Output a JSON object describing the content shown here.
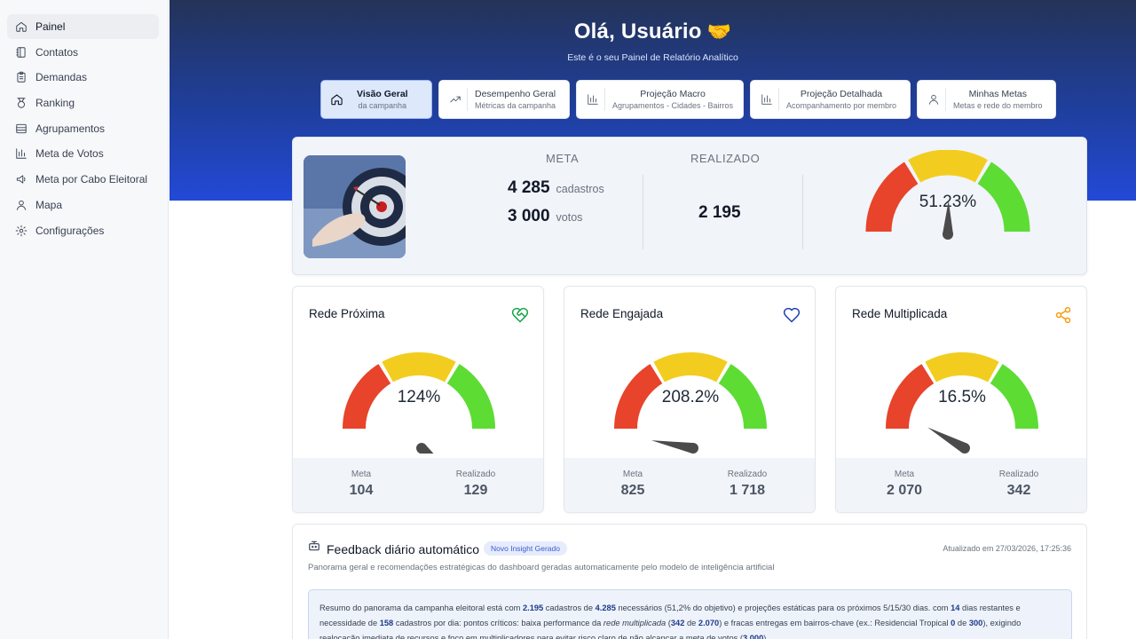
{
  "sidebar": {
    "items": [
      {
        "label": "Painel",
        "icon": "home-icon",
        "active": true
      },
      {
        "label": "Contatos",
        "icon": "contacts-book-icon"
      },
      {
        "label": "Demandas",
        "icon": "clipboard-icon"
      },
      {
        "label": "Ranking",
        "icon": "medal-icon"
      },
      {
        "label": "Agrupamentos",
        "icon": "layers-icon"
      },
      {
        "label": "Meta de Votos",
        "icon": "bar-chart-icon"
      },
      {
        "label": "Meta por Cabo Eleitoral",
        "icon": "megaphone-icon"
      },
      {
        "label": "Mapa",
        "icon": "map-pin-icon"
      },
      {
        "label": "Configurações",
        "icon": "gear-icon"
      }
    ]
  },
  "header": {
    "greeting": "Olá, Usuário",
    "greeting_icon": "handshake-icon",
    "subtitle": "Este é o seu Painel de Relatório Analítico"
  },
  "tabs": [
    {
      "title": "Visão Geral",
      "sub": "da campanha",
      "icon": "home-icon",
      "active": true
    },
    {
      "title": "Desempenho Geral",
      "sub": "Métricas da campanha",
      "icon": "trending-up-icon"
    },
    {
      "title": "Projeção Macro",
      "sub": "Agrupamentos - Cidades - Bairros",
      "icon": "bar-chart-icon"
    },
    {
      "title": "Projeção Detalhada",
      "sub": "Acompanhamento por membro",
      "icon": "bar-chart-icon"
    },
    {
      "title": "Minhas Metas",
      "sub": "Metas e rede do membro",
      "icon": "user-icon"
    }
  ],
  "summary": {
    "meta_label": "META",
    "realizado_label": "REALIZADO",
    "meta_cadastros": "4 285",
    "meta_cadastros_unit": "cadastros",
    "meta_votos": "3 000",
    "meta_votos_unit": "votos",
    "realizado": "2 195",
    "gauge_text": "51.23%",
    "gauge_value": 51.23
  },
  "networks": [
    {
      "title": "Rede Próxima",
      "icon": "heart-handshake-icon",
      "icon_color": "#16a34a",
      "percent_text": "124%",
      "percent": 124,
      "meta_label": "Meta",
      "meta": "104",
      "realizado_label": "Realizado",
      "realizado": "129"
    },
    {
      "title": "Rede Engajada",
      "icon": "heart-icon",
      "icon_color": "#1e40af",
      "percent_text": "208.2%",
      "percent": 208.2,
      "meta_label": "Meta",
      "meta": "825",
      "realizado_label": "Realizado",
      "realizado": "1 718"
    },
    {
      "title": "Rede Multiplicada",
      "icon": "share-icon",
      "icon_color": "#f59e0b",
      "percent_text": "16.5%",
      "percent": 16.5,
      "meta_label": "Meta",
      "meta": "2 070",
      "realizado_label": "Realizado",
      "realizado": "342"
    }
  ],
  "feedback": {
    "title": "Feedback diário automático",
    "icon": "bot-icon",
    "badge": "Novo Insight Gerado",
    "updated": "Atualizado em 27/03/2026, 17:25:36",
    "description": "Panorama geral e recomendações estratégicas do dashboard geradas automaticamente pelo modelo de inteligência artificial",
    "body_parts": [
      {
        "t": "Resumo do panorama da campanha eleitoral está com ",
        "s": "n"
      },
      {
        "t": "2.195",
        "s": "b"
      },
      {
        "t": " cadastros de ",
        "s": "n"
      },
      {
        "t": "4.285",
        "s": "b"
      },
      {
        "t": " necessários (51,2% do objetivo) e projeções estáticas para os próximos 5/15/30 dias. com ",
        "s": "n"
      },
      {
        "t": "14",
        "s": "b"
      },
      {
        "t": " dias restantes e necessidade de ",
        "s": "n"
      },
      {
        "t": "158",
        "s": "b"
      },
      {
        "t": " cadastros por dia: pontos críticos: baixa performance da ",
        "s": "n"
      },
      {
        "t": "rede multiplicada",
        "s": "i"
      },
      {
        "t": " (",
        "s": "n"
      },
      {
        "t": "342",
        "s": "b"
      },
      {
        "t": " de ",
        "s": "n"
      },
      {
        "t": "2.070",
        "s": "b"
      },
      {
        "t": ") e fracas entregas em bairros-chave (ex.: Residencial Tropical ",
        "s": "n"
      },
      {
        "t": "0",
        "s": "b"
      },
      {
        "t": " de ",
        "s": "n"
      },
      {
        "t": "300",
        "s": "b"
      },
      {
        "t": "), exigindo realocação imediata de recursos e foco em multiplicadores para evitar risco claro de não alcançar a meta de votos (",
        "s": "n"
      },
      {
        "t": "3.000",
        "s": "b"
      },
      {
        "t": ").",
        "s": "n"
      }
    ]
  },
  "colors": {
    "gauge_red": "#e8432b",
    "gauge_yellow": "#f2cd1f",
    "gauge_green": "#5ddc34",
    "needle": "#4b4b4b",
    "header_top": "#243358",
    "header_bottom": "#2349d6"
  }
}
